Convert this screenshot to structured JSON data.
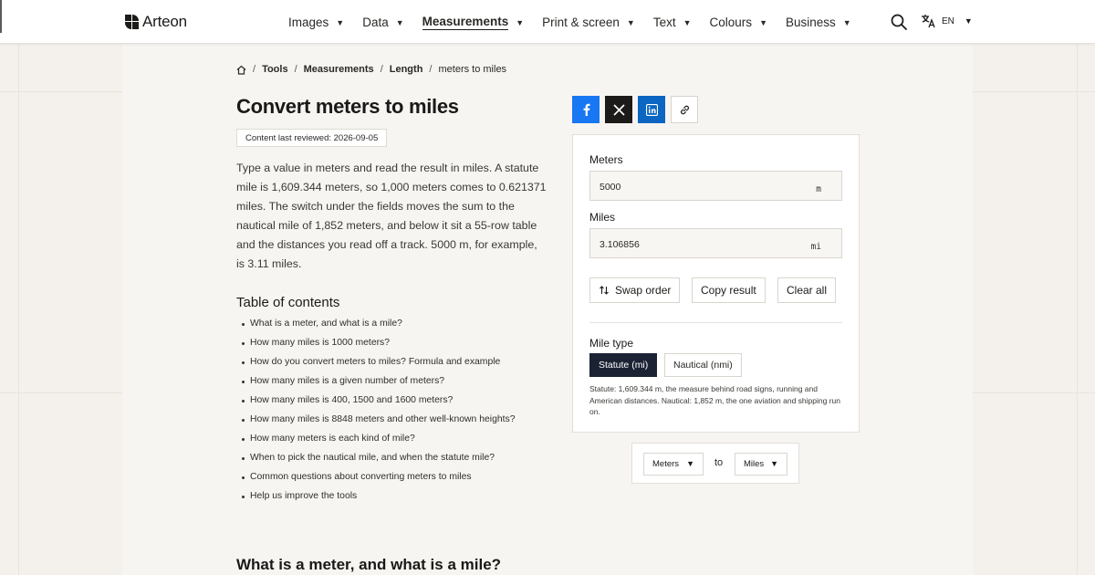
{
  "header": {
    "brand": "Arteon",
    "nav": [
      {
        "label": "Images",
        "active": false
      },
      {
        "label": "Data",
        "active": false
      },
      {
        "label": "Measurements",
        "active": true
      },
      {
        "label": "Print & screen",
        "active": false
      },
      {
        "label": "Text",
        "active": false
      },
      {
        "label": "Colours",
        "active": false
      },
      {
        "label": "Business",
        "active": false
      }
    ],
    "language": "EN"
  },
  "breadcrumb": {
    "items": [
      "Tools",
      "Measurements",
      "Length"
    ],
    "current": "meters to miles"
  },
  "article": {
    "title": "Convert meters to miles",
    "reviewed": "Content last reviewed: 2026-09-05",
    "intro": "Type a value in meters and read the result in miles. A statute mile is 1,609.344 meters, so 1,000 meters comes to 0.621371 miles. The switch under the fields moves the sum to the nautical mile of 1,852 meters, and below it sit a 55-row table and the distances you read off a track. 5000 m, for example, is 3.11 miles.",
    "toc_title": "Table of contents",
    "toc": [
      "What is a meter, and what is a mile?",
      "How many miles is 1000 meters?",
      "How do you convert meters to miles? Formula and example",
      "How many miles is a given number of meters?",
      "How many miles is 400, 1500 and 1600 meters?",
      "How many miles is 8848 meters and other well-known heights?",
      "How many meters is each kind of mile?",
      "When to pick the nautical mile, and when the statute mile?",
      "Common questions about converting meters to miles",
      "Help us improve the tools"
    ],
    "next_heading": "What is a meter, and what is a mile?"
  },
  "converter": {
    "from_label": "Meters",
    "from_value": "5000",
    "from_unit": "m",
    "to_label": "Miles",
    "to_value": "3.106856",
    "to_unit": "mi",
    "swap_label": "Swap order",
    "copy_label": "Copy result",
    "clear_label": "Clear all",
    "mile_type_label": "Mile type",
    "mile_options": [
      "Statute (mi)",
      "Nautical (nmi)"
    ],
    "mile_selected": "Statute (mi)",
    "note": "Statute: 1,609.344 m, the measure behind road signs, running and American distances. Nautical: 1,852 m, the one aviation and shipping run on."
  },
  "pickers": {
    "from": "Meters",
    "connector": "to",
    "to": "Miles"
  },
  "colors": {
    "accent_dark": "#1b2233",
    "facebook": "#1877f2",
    "linkedin": "#0a66c2",
    "x": "#1c1b19"
  },
  "icons": [
    "home-icon",
    "search-icon",
    "translate-icon",
    "facebook-icon",
    "x-icon",
    "linkedin-icon",
    "link-icon",
    "swap-icon"
  ]
}
